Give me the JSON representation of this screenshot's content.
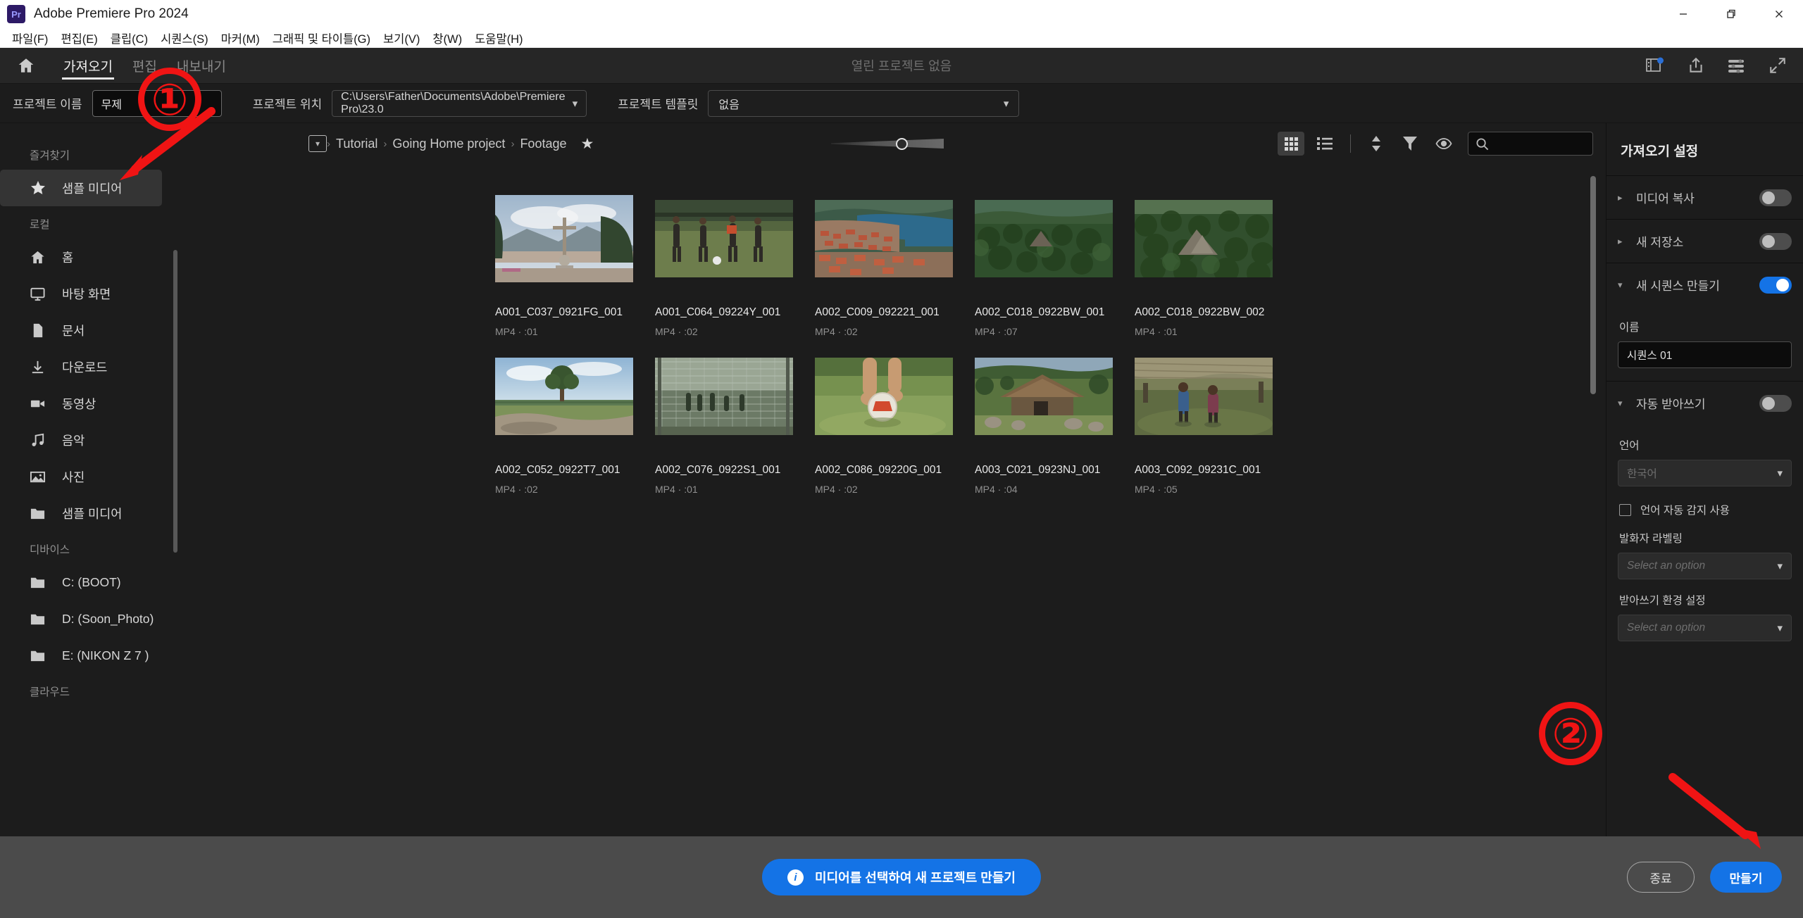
{
  "window": {
    "title": "Adobe Premiere Pro 2024",
    "logo_text": "Pr",
    "minimize": "—",
    "restore": "❐",
    "close": "✕"
  },
  "menubar": [
    "파일(F)",
    "편집(E)",
    "클립(C)",
    "시퀀스(S)",
    "마커(M)",
    "그래픽 및 타이틀(G)",
    "보기(V)",
    "창(W)",
    "도움말(H)"
  ],
  "header": {
    "tabs": [
      {
        "label": "가져오기",
        "active": true
      },
      {
        "label": "편집",
        "active": false
      },
      {
        "label": "내보내기",
        "active": false
      }
    ],
    "center_status": "열린 프로젝트 없음",
    "icons": [
      "panel-badge-icon",
      "share-icon",
      "settings-sliders-icon",
      "fullscreen-icon"
    ]
  },
  "project_row": {
    "name_label": "프로젝트 이름",
    "name_value": "무제",
    "location_label": "프로젝트 위치",
    "location_value": "C:\\Users\\Father\\Documents\\Adobe\\Premiere Pro\\23.0",
    "template_label": "프로젝트 템플릿",
    "template_value": "없음"
  },
  "sidebar": {
    "groups": [
      {
        "title": "즐겨찾기",
        "items": [
          {
            "label": "샘플 미디어",
            "icon": "star-icon",
            "selected": true
          }
        ]
      },
      {
        "title": "로컬",
        "items": [
          {
            "label": "홈",
            "icon": "home-icon",
            "selected": false
          },
          {
            "label": "바탕 화면",
            "icon": "desktop-icon",
            "selected": false
          },
          {
            "label": "문서",
            "icon": "document-icon",
            "selected": false
          },
          {
            "label": "다운로드",
            "icon": "download-icon",
            "selected": false
          },
          {
            "label": "동영상",
            "icon": "video-icon",
            "selected": false
          },
          {
            "label": "음악",
            "icon": "music-icon",
            "selected": false
          },
          {
            "label": "사진",
            "icon": "photo-icon",
            "selected": false
          },
          {
            "label": "샘플 미디어",
            "icon": "folder-icon",
            "selected": false
          }
        ]
      },
      {
        "title": "디바이스",
        "items": [
          {
            "label": "C: (BOOT)",
            "icon": "folder-icon",
            "selected": false
          },
          {
            "label": "D: (Soon_Photo)",
            "icon": "folder-icon",
            "selected": false
          },
          {
            "label": "E: (NIKON Z 7 )",
            "icon": "folder-icon",
            "selected": false
          }
        ]
      },
      {
        "title": "클라우드",
        "items": []
      }
    ]
  },
  "browser": {
    "breadcrumb": [
      "Tutorial",
      "Going Home project",
      "Footage"
    ],
    "breadcrumb_star": "★",
    "search_value": "",
    "toolbar_icons": [
      "grid-view-icon",
      "list-view-icon",
      "sort-icon",
      "filter-icon",
      "eye-icon",
      "search-icon"
    ],
    "grid_view_active": true,
    "files": [
      {
        "name": "A001_C037_0921FG_001",
        "meta": "MP4 · :01",
        "thumb": "cross-hill"
      },
      {
        "name": "A001_C064_09224Y_001",
        "meta": "MP4 · :02",
        "thumb": "soccer"
      },
      {
        "name": "A002_C009_092221_001",
        "meta": "MP4 · :02",
        "thumb": "lake-town"
      },
      {
        "name": "A002_C018_0922BW_001",
        "meta": "MP4 · :07",
        "thumb": "jungle1"
      },
      {
        "name": "A002_C018_0922BW_002",
        "meta": "MP4 · :01",
        "thumb": "jungle2"
      },
      {
        "name": "A002_C052_0922T7_001",
        "meta": "MP4 · :02",
        "thumb": "field-tree"
      },
      {
        "name": "A002_C076_0922S1_001",
        "meta": "MP4 · :01",
        "thumb": "fence-kids"
      },
      {
        "name": "A002_C086_09220G_001",
        "meta": "MP4 · :02",
        "thumb": "feet-ball"
      },
      {
        "name": "A003_C021_0923NJ_001",
        "meta": "MP4 · :04",
        "thumb": "hut-stones"
      },
      {
        "name": "A003_C092_09231C_001",
        "meta": "MP4 · :05",
        "thumb": "kids-hut"
      }
    ]
  },
  "import_settings": {
    "title": "가져오기 설정",
    "sections": [
      {
        "label": "미디어 복사",
        "expanded": false,
        "enabled": false
      },
      {
        "label": "새 저장소",
        "expanded": false,
        "enabled": false
      },
      {
        "label": "새 시퀀스 만들기",
        "expanded": true,
        "enabled": true
      },
      {
        "label": "자동 받아쓰기",
        "expanded": true,
        "enabled": false
      }
    ],
    "sequence_name_label": "이름",
    "sequence_name_value": "시퀀스 01",
    "language_label": "언어",
    "language_value": "한국어",
    "autodetect_label": "언어 자동 감지 사용",
    "autodetect_checked": false,
    "speaker_label": "발화자 라벨링",
    "speaker_value": "Select an option",
    "prefs_label": "받아쓰기 환경 설정",
    "prefs_value": "Select an option"
  },
  "footer": {
    "banner_text": "미디어를 선택하여 새 프로젝트 만들기",
    "banner_icon": "info-icon",
    "cancel_label": "종료",
    "create_label": "만들기"
  },
  "annotations": [
    {
      "label": "①"
    },
    {
      "label": "②"
    }
  ],
  "colors": {
    "accent": "#1473e6",
    "annotation": "#f01414",
    "panel_bg": "#1c1c1c",
    "footer_bg": "#4b4b4b"
  }
}
